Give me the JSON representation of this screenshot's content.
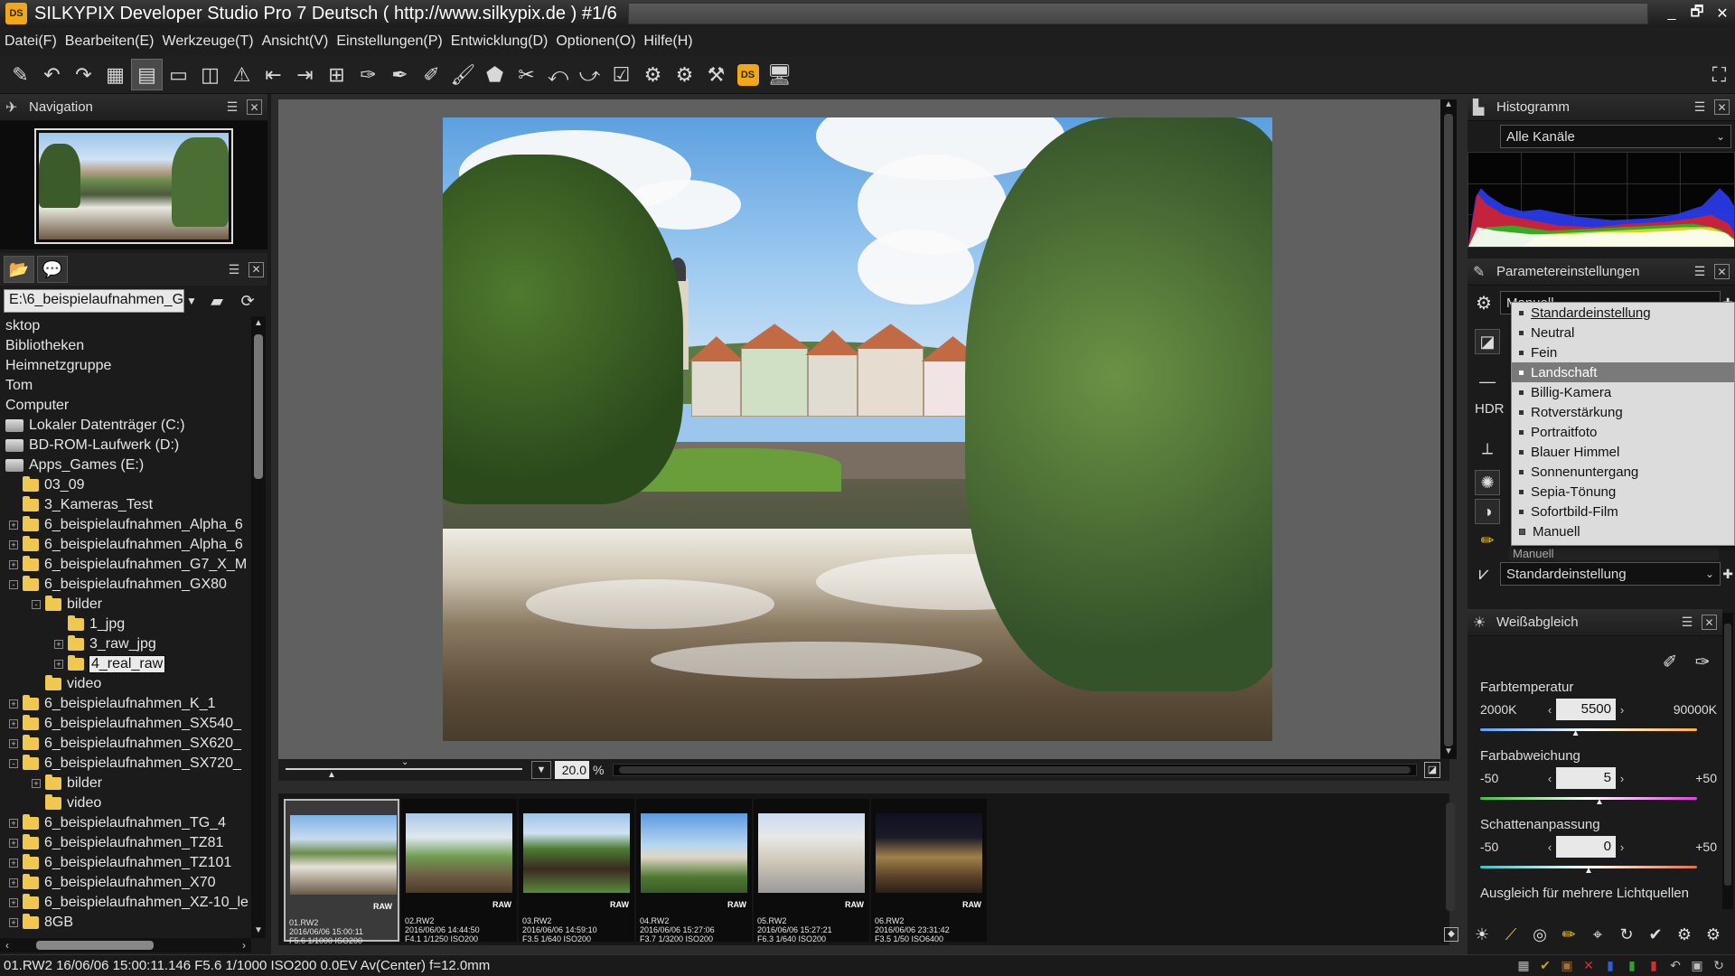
{
  "window": {
    "logo": "DS",
    "title": "SILKYPIX Developer Studio Pro 7 Deutsch ( http://www.silkypix.de )   #1/6",
    "controls": [
      "_",
      "🗗",
      "✕"
    ]
  },
  "menu": [
    "Datei(F)",
    "Bearbeiten(E)",
    "Werkzeuge(T)",
    "Ansicht(V)",
    "Einstellungen(P)",
    "Entwicklung(D)",
    "Optionen(O)",
    "Hilfe(H)"
  ],
  "toolbar": {
    "icons": [
      "✎",
      "↶",
      "↷",
      "▦",
      "▤",
      "▭",
      "◫",
      "⚠",
      "⇤",
      "⇥",
      "⊞",
      "✑",
      "✒",
      "✐",
      "🖌",
      "⬟",
      "✂",
      "⤺",
      "⤻",
      "☑",
      "⚙",
      "⚙",
      "⚒",
      "DS",
      "🖥"
    ],
    "fullscreen_icon": "⛶"
  },
  "navigation": {
    "title": "Navigation",
    "menu_icon": "☰",
    "close_icon": "✕"
  },
  "browser": {
    "tab_icons": [
      "📂",
      "💬"
    ],
    "path": "E:\\6_beispielaufnahmen_G",
    "tree": [
      {
        "label": "sktop",
        "indent": 0,
        "expander": "",
        "icon": "none"
      },
      {
        "label": "Bibliotheken",
        "indent": 0,
        "expander": "",
        "icon": "none"
      },
      {
        "label": "Heimnetzgruppe",
        "indent": 0,
        "expander": "",
        "icon": "none"
      },
      {
        "label": "Tom",
        "indent": 0,
        "expander": "",
        "icon": "none"
      },
      {
        "label": "Computer",
        "indent": 0,
        "expander": "",
        "icon": "none"
      },
      {
        "label": "Lokaler Datenträger (C:)",
        "indent": 0,
        "expander": "",
        "icon": "drive"
      },
      {
        "label": "BD-ROM-Laufwerk (D:)",
        "indent": 0,
        "expander": "",
        "icon": "drive"
      },
      {
        "label": "Apps_Games (E:)",
        "indent": 0,
        "expander": "",
        "icon": "drive"
      },
      {
        "label": "03_09",
        "indent": 1,
        "expander": "",
        "icon": "folder"
      },
      {
        "label": "3_Kameras_Test",
        "indent": 1,
        "expander": "",
        "icon": "folder"
      },
      {
        "label": "6_beispielaufnahmen_Alpha_6",
        "indent": 1,
        "expander": "+",
        "icon": "folder"
      },
      {
        "label": "6_beispielaufnahmen_Alpha_6",
        "indent": 1,
        "expander": "+",
        "icon": "folder"
      },
      {
        "label": "6_beispielaufnahmen_G7_X_M",
        "indent": 1,
        "expander": "+",
        "icon": "folder"
      },
      {
        "label": "6_beispielaufnahmen_GX80",
        "indent": 1,
        "expander": "-",
        "icon": "folder"
      },
      {
        "label": "bilder",
        "indent": 2,
        "expander": "-",
        "icon": "folder"
      },
      {
        "label": "1_jpg",
        "indent": 3,
        "expander": "",
        "icon": "folder"
      },
      {
        "label": "3_raw_jpg",
        "indent": 3,
        "expander": "+",
        "icon": "folder"
      },
      {
        "label": "4_real_raw",
        "indent": 3,
        "expander": "+",
        "icon": "folder",
        "selected": true
      },
      {
        "label": "video",
        "indent": 2,
        "expander": "",
        "icon": "folder"
      },
      {
        "label": "6_beispielaufnahmen_K_1",
        "indent": 1,
        "expander": "+",
        "icon": "folder"
      },
      {
        "label": "6_beispielaufnahmen_SX540_",
        "indent": 1,
        "expander": "+",
        "icon": "folder"
      },
      {
        "label": "6_beispielaufnahmen_SX620_",
        "indent": 1,
        "expander": "+",
        "icon": "folder"
      },
      {
        "label": "6_beispielaufnahmen_SX720_",
        "indent": 1,
        "expander": "-",
        "icon": "folder"
      },
      {
        "label": "bilder",
        "indent": 2,
        "expander": "+",
        "icon": "folder"
      },
      {
        "label": "video",
        "indent": 2,
        "expander": "",
        "icon": "folder"
      },
      {
        "label": "6_beispielaufnahmen_TG_4",
        "indent": 1,
        "expander": "+",
        "icon": "folder"
      },
      {
        "label": "6_beispielaufnahmen_TZ81",
        "indent": 1,
        "expander": "+",
        "icon": "folder"
      },
      {
        "label": "6_beispielaufnahmen_TZ101",
        "indent": 1,
        "expander": "+",
        "icon": "folder"
      },
      {
        "label": "6_beispielaufnahmen_X70",
        "indent": 1,
        "expander": "+",
        "icon": "folder"
      },
      {
        "label": "6_beispielaufnahmen_XZ-10_le",
        "indent": 1,
        "expander": "+",
        "icon": "folder"
      },
      {
        "label": "8GB",
        "indent": 1,
        "expander": "+",
        "icon": "folder"
      }
    ]
  },
  "viewer": {
    "zoom_value": "20.0",
    "zoom_unit": "%"
  },
  "filmstrip": [
    {
      "name": "01.RW2",
      "datetime": "2016/06/06 15:00:11",
      "exposure": "F5.6 1/1000 ISO200",
      "raw": "RAW",
      "selected": true
    },
    {
      "name": "02.RW2",
      "datetime": "2016/06/06 14:44:50",
      "exposure": "F4.1 1/1250 ISO200",
      "raw": "RAW"
    },
    {
      "name": "03.RW2",
      "datetime": "2016/06/06 14:59:10",
      "exposure": "F3.5 1/640 ISO200",
      "raw": "RAW"
    },
    {
      "name": "04.RW2",
      "datetime": "2016/06/06 15:27:06",
      "exposure": "F3.7 1/3200 ISO200",
      "raw": "RAW"
    },
    {
      "name": "05.RW2",
      "datetime": "2016/06/06 15:27:21",
      "exposure": "F6.3 1/640 ISO200",
      "raw": "RAW"
    },
    {
      "name": "06.RW2",
      "datetime": "2016/06/06 23:31:42",
      "exposure": "F3.5 1/50 ISO6400",
      "raw": "RAW"
    }
  ],
  "histogram": {
    "title": "Histogramm",
    "channel": "Alle Kanäle"
  },
  "params": {
    "title": "Parametereinstellungen",
    "preset_value": "Manuell",
    "hdr_label": "HDR",
    "hidden_value": "Manuell",
    "bottom_value": "Standardeinstellung",
    "dropdown": [
      {
        "label": "Standardeinstellung",
        "state": "first"
      },
      {
        "label": "Neutral",
        "state": ""
      },
      {
        "label": "Fein",
        "state": ""
      },
      {
        "label": "Landschaft",
        "state": "hover"
      },
      {
        "label": "Billig-Kamera",
        "state": ""
      },
      {
        "label": "Rotverstärkung",
        "state": ""
      },
      {
        "label": "Portraitfoto",
        "state": ""
      },
      {
        "label": "Blauer Himmel",
        "state": ""
      },
      {
        "label": "Sonnenuntergang",
        "state": ""
      },
      {
        "label": "Sepia-Tönung",
        "state": ""
      },
      {
        "label": "Sofortbild-Film",
        "state": ""
      },
      {
        "label": "Manuell",
        "state": "checked"
      }
    ]
  },
  "white_balance": {
    "title": "Weißabgleich",
    "temperature": {
      "label": "Farbtemperatur",
      "min": "2000K",
      "value": "5500",
      "max": "90000K",
      "fraction": 0.44
    },
    "deviation": {
      "label": "Farbabweichung",
      "min": "-50",
      "value": "5",
      "max": "+50",
      "fraction": 0.55
    },
    "shadow": {
      "label": "Schattenanpassung",
      "min": "-50",
      "value": "0",
      "max": "+50",
      "fraction": 0.5
    },
    "multi_light": "Ausgleich für mehrere Lichtquellen"
  },
  "bottom_tools": [
    "☀",
    "⟋",
    "◎",
    "✏",
    "⌖",
    "↻",
    "✔",
    "⚙",
    "⚙"
  ],
  "status": {
    "text": "01.RW2 16/06/06 15:00:11.146 F5.6 1/1000 ISO200  0.0EV Av(Center) f=12.0mm",
    "icons": [
      "▦",
      "✔",
      "▣",
      "✕",
      "▮",
      "▮",
      "▮",
      "↶",
      "▣",
      "↻"
    ]
  },
  "colors": {
    "background": "#2b2b2b",
    "panel": "#1b1b1b",
    "accent": "#f0a818"
  }
}
